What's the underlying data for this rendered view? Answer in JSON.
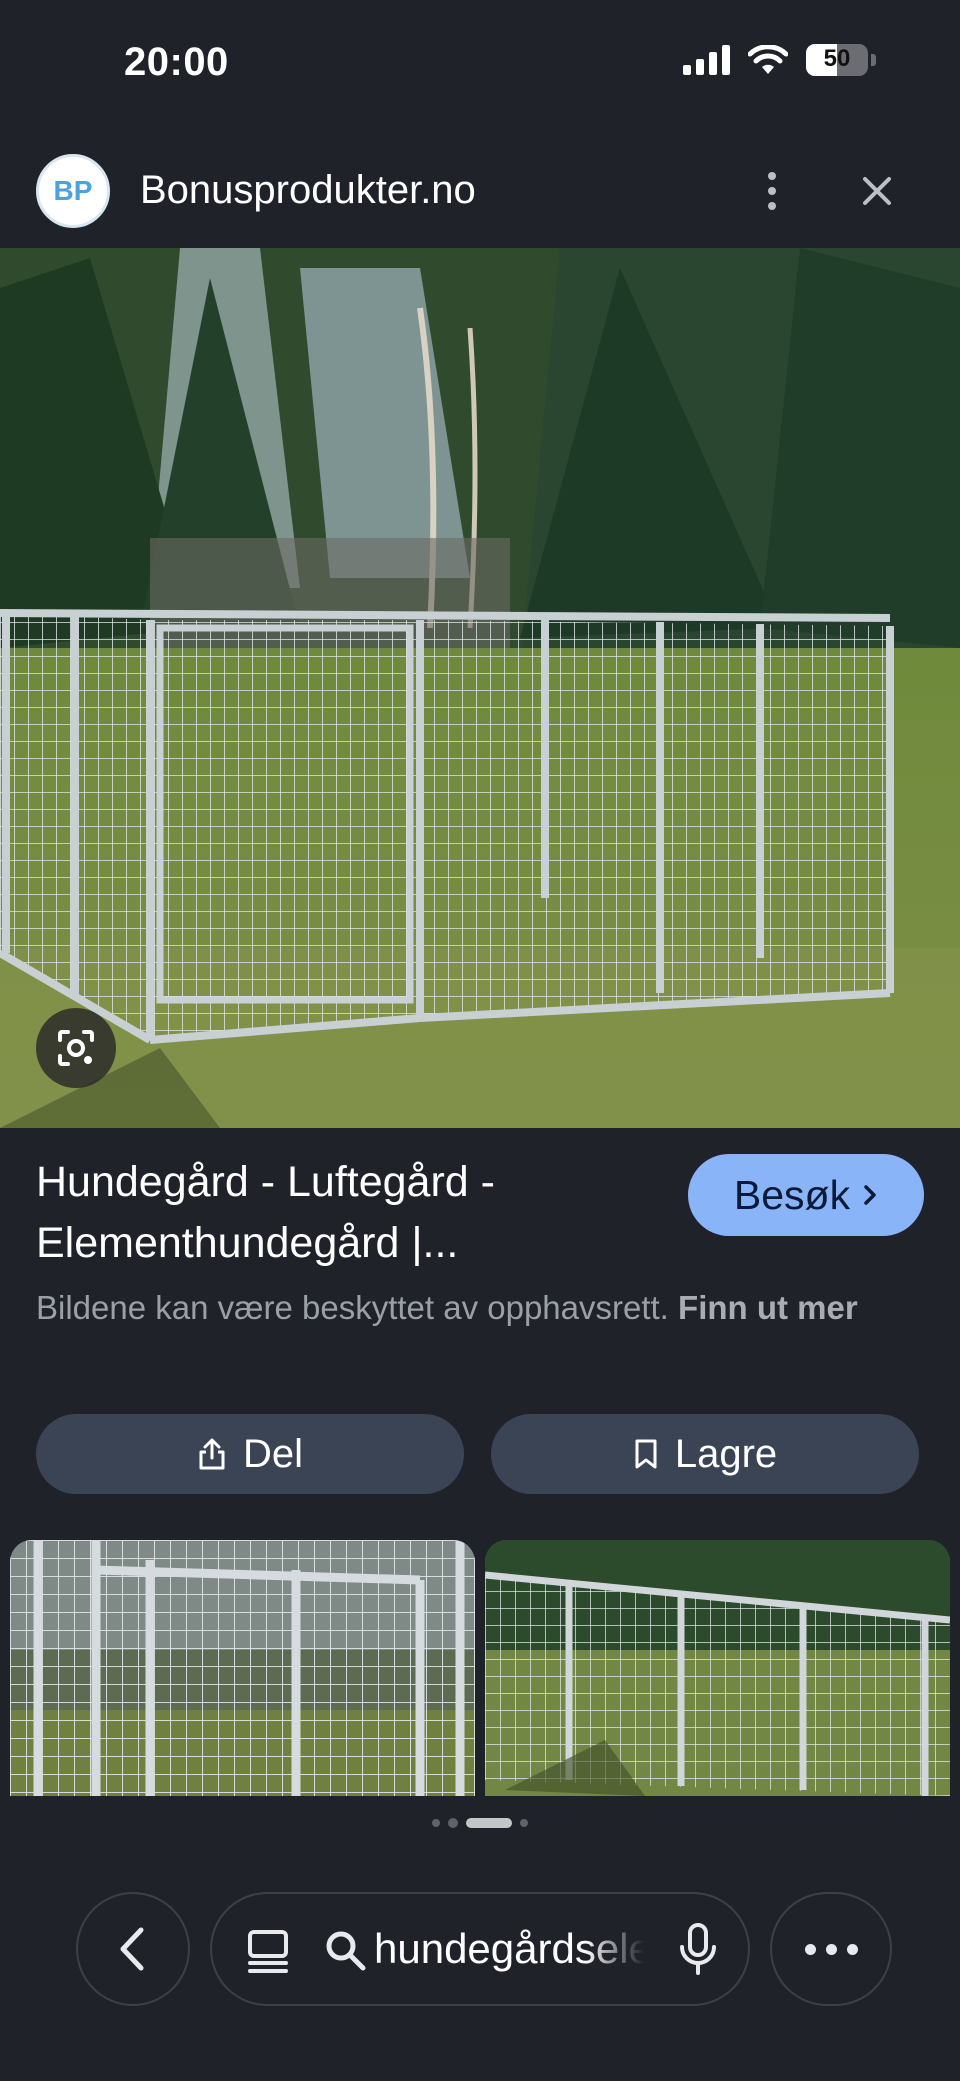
{
  "status_bar": {
    "time": "20:00",
    "battery_level": "50",
    "battery_fraction": 0.5,
    "icons": [
      "cellular-signal-icon",
      "wifi-icon",
      "battery-icon"
    ]
  },
  "header": {
    "avatar_initials": "BP",
    "site_name": "Bonusprodukter.no",
    "icons": [
      "more-vertical-icon",
      "close-icon"
    ]
  },
  "result": {
    "title": "Hundegård - Luftegård - Elementhundegård |...",
    "visit_label": "Besøk",
    "copyright_text": "Bildene kan være beskyttet av opphavsrett.",
    "learn_more": "Finn ut mer",
    "share_label": "Del",
    "save_label": "Lagre"
  },
  "carousel": {
    "dot_count": 4,
    "active_dot": 2
  },
  "bottom_bar": {
    "search_query": "hundegårdselementer",
    "icons": [
      "back-icon",
      "tabs-icon",
      "search-icon",
      "mic-icon",
      "more-horizontal-icon"
    ]
  },
  "colors": {
    "background": "#20222a",
    "accent": "#8ab4f8",
    "button_bg": "#3b4454",
    "muted_text": "#9aa0a6"
  }
}
